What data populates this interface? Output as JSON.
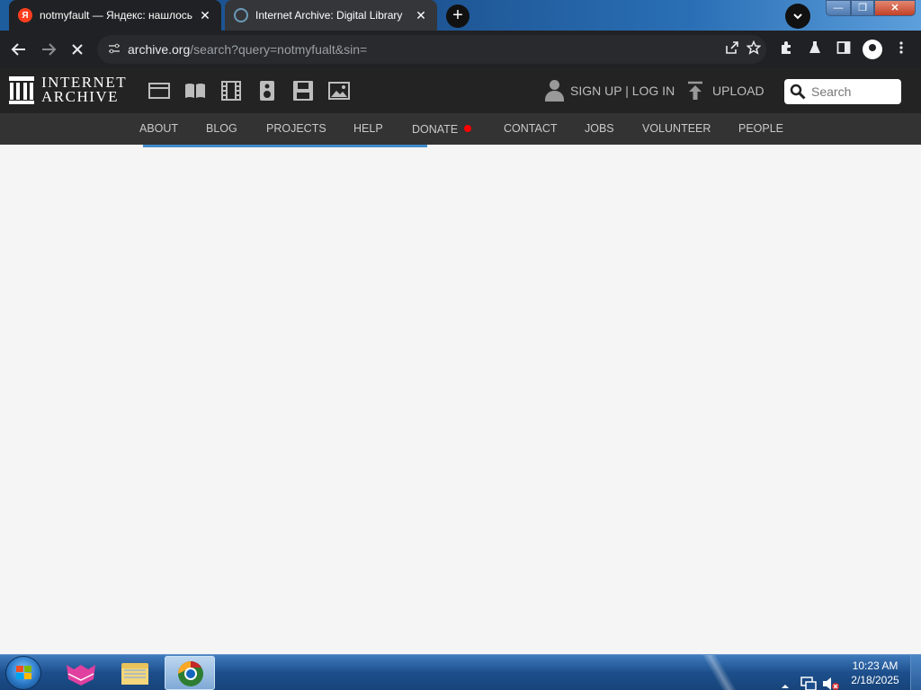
{
  "browser": {
    "tabs": [
      {
        "title": "notmyfault — Яндекс: нашлось",
        "favicon": "yandex-favicon",
        "favicon_letter": "Я",
        "close": "✕"
      },
      {
        "title": "Internet Archive: Digital Library",
        "favicon": "internet-archive-favicon",
        "close": "✕"
      }
    ],
    "new_tab": "+",
    "tab_search": "⌄",
    "window_buttons": {
      "minimize": "—",
      "maximize": "❐",
      "close": "✕"
    },
    "address": {
      "host": "archive.org",
      "path": "/search?query=notmyfualt&sin="
    },
    "icons": [
      "back-icon",
      "forward-icon",
      "stop-loading-icon",
      "site-info-icon",
      "share-icon",
      "bookmark-star-icon",
      "extensions-icon",
      "labs-flask-icon",
      "side-panel-icon",
      "profile-icon",
      "menu-icon"
    ]
  },
  "ia": {
    "logo": {
      "line1": "INTERNET",
      "line2": "ARCHIVE"
    },
    "media_icons": [
      "web-icon",
      "texts-icon",
      "video-icon",
      "audio-icon",
      "software-icon",
      "images-icon"
    ],
    "signup_login": "SIGN UP | LOG IN",
    "upload": "UPLOAD",
    "search_placeholder": "Search",
    "nav": [
      "ABOUT",
      "BLOG",
      "PROJECTS",
      "HELP",
      "DONATE",
      "CONTACT",
      "JOBS",
      "VOLUNTEER",
      "PEOPLE"
    ],
    "loading_progress": 0.31,
    "colors": {
      "header": "#232323",
      "nav": "#333333",
      "progress": "#428bca",
      "donate_dot": "#ff0000"
    }
  },
  "taskbar": {
    "pinned": [
      "start-orb",
      "yandex-browser-icon",
      "file-explorer-icon",
      "chrome-icon"
    ],
    "tray_icons": [
      "show-hidden-icons-chevron",
      "network-icon",
      "volume-muted-icon"
    ],
    "time": "10:23 AM",
    "date": "2/18/2025"
  }
}
